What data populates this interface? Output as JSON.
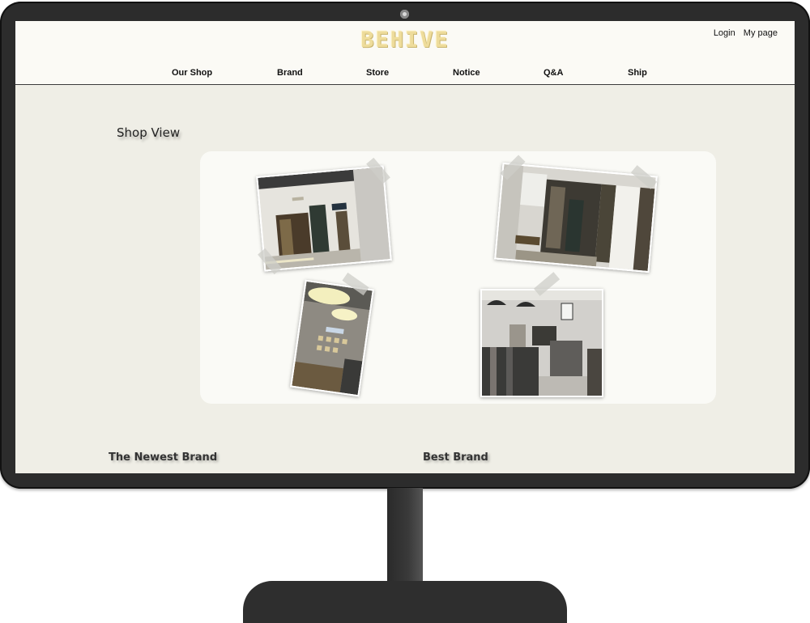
{
  "site": {
    "logo": "BEHIVE"
  },
  "account": {
    "login": "Login",
    "mypage": "My page"
  },
  "nav": [
    "Our Shop",
    "Brand",
    "Store",
    "Notice",
    "Q&A",
    "Ship"
  ],
  "shop_view": {
    "title": "Shop View"
  },
  "bottom": {
    "newest_brand": "The Newest Brand",
    "best_brand": "Best Brand"
  },
  "colors": {
    "logo": "#eedc9b",
    "screen_bg": "#efeee6",
    "header_bg": "#fbfaf5",
    "frame": "#2c2c2c"
  }
}
